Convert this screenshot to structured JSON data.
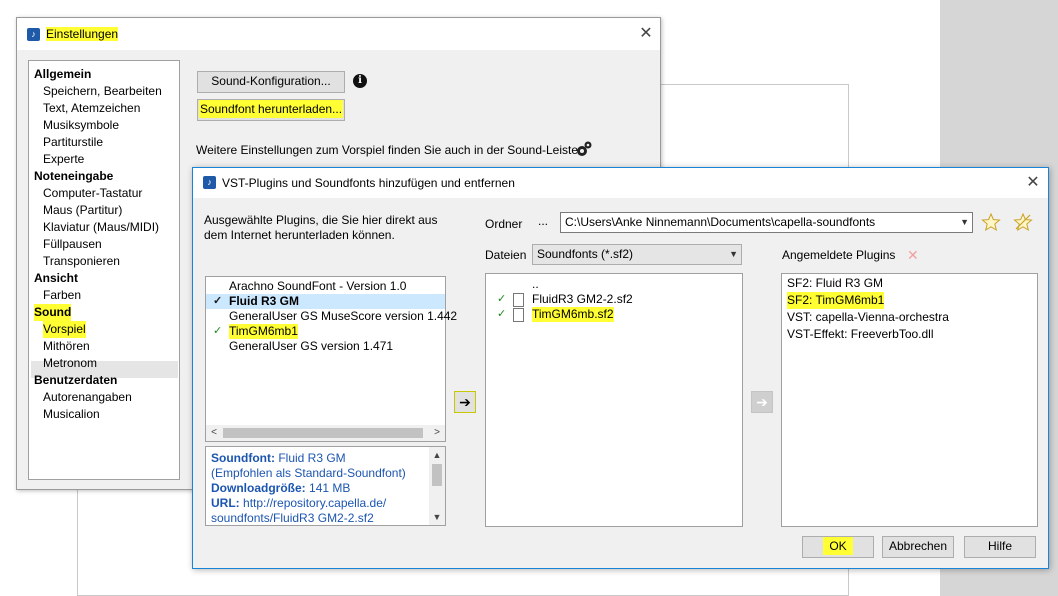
{
  "settings_window": {
    "title": "Einstellungen",
    "tree": [
      {
        "label": "Allgemein",
        "kind": "cat"
      },
      {
        "label": "Speichern, Bearbeiten",
        "kind": "sub"
      },
      {
        "label": "Text, Atemzeichen",
        "kind": "sub"
      },
      {
        "label": "Musiksymbole",
        "kind": "sub"
      },
      {
        "label": "Partiturstile",
        "kind": "sub"
      },
      {
        "label": "Experte",
        "kind": "sub"
      },
      {
        "label": "Noteneingabe",
        "kind": "cat"
      },
      {
        "label": "Computer-Tastatur",
        "kind": "sub"
      },
      {
        "label": "Maus (Partitur)",
        "kind": "sub"
      },
      {
        "label": "Klaviatur (Maus/MIDI)",
        "kind": "sub"
      },
      {
        "label": "Füllpausen",
        "kind": "sub"
      },
      {
        "label": "Transponieren",
        "kind": "sub"
      },
      {
        "label": "Ansicht",
        "kind": "cat"
      },
      {
        "label": "Farben",
        "kind": "sub"
      },
      {
        "label": "Sound",
        "kind": "cat"
      },
      {
        "label": "Vorspiel",
        "kind": "sub"
      },
      {
        "label": "Mithören",
        "kind": "sub"
      },
      {
        "label": "Metronom",
        "kind": "sub"
      },
      {
        "label": "Benutzerdaten",
        "kind": "cat"
      },
      {
        "label": "Autorenangaben",
        "kind": "sub"
      },
      {
        "label": "Musicalion",
        "kind": "sub"
      }
    ],
    "sound_config_button": "Sound-Konfiguration...",
    "soundfont_download_button": "Soundfont herunterladen...",
    "hint_text": "Weitere Einstellungen zum Vorspiel finden Sie auch in der Sound-Leiste"
  },
  "vst_window": {
    "title": "VST-Plugins und Soundfonts hinzufügen und entfernen",
    "description_line1": "Ausgewählte Plugins, die Sie hier direkt aus",
    "description_line2": "dem Internet herunterladen können.",
    "plugins": [
      {
        "name": "Arachno SoundFont - Version 1.0",
        "check": ""
      },
      {
        "name": "Fluid R3 GM",
        "check": "✓"
      },
      {
        "name": "GeneralUser GS MuseScore version 1.442",
        "check": ""
      },
      {
        "name": "TimGM6mb1",
        "check": "✓"
      },
      {
        "name": "GeneralUser GS version 1.471",
        "check": ""
      }
    ],
    "info": {
      "soundfont_label": "Soundfont:",
      "soundfont_value": "Fluid R3 GM",
      "recommendation": "(Empfohlen als Standard-Soundfont)",
      "download_size_label": "Downloadgröße:",
      "download_size_value": "141 MB",
      "url_label": "URL:",
      "url_value_line1": "http://repository.capella.de/",
      "url_value_line2": "soundfonts/FluidR3 GM2-2.sf2"
    },
    "folder_label": "Ordner",
    "folder_dots": "...",
    "folder_path": "C:\\Users\\Anke Ninnemann\\Documents\\capella-soundfonts",
    "files_label": "Dateien",
    "files_filter": "Soundfonts (*.sf2)",
    "files": [
      {
        "name": "..",
        "check": "",
        "icon": false
      },
      {
        "name": "FluidR3 GM2-2.sf2",
        "check": "✓",
        "icon": true
      },
      {
        "name": "TimGM6mb.sf2",
        "check": "✓",
        "icon": true
      }
    ],
    "registered_label": "Angemeldete Plugins",
    "registered": [
      "SF2: Fluid R3 GM",
      "SF2: TimGM6mb1",
      "VST: capella-Vienna-orchestra",
      "VST-Effekt: FreeverbToo.dll"
    ],
    "ok_button": "OK",
    "cancel_button": "Abbrechen",
    "help_button": "Hilfe",
    "accent_color": "#1883d7",
    "highlight_color": "#ffff33"
  }
}
